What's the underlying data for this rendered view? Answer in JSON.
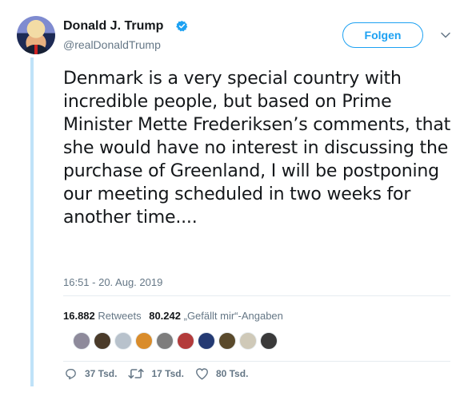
{
  "user": {
    "name": "Donald J. Trump",
    "handle": "@realDonaldTrump",
    "verified": true,
    "follow_label": "Folgen"
  },
  "tweet": {
    "text": "Denmark is a very special country with incredible people, but based on Prime Minister Mette Frederiksen’s comments, that she would have no interest in discussing the purchase of Greenland, I will be postponing our meeting scheduled in two weeks for another time....",
    "timestamp": "16:51 - 20. Aug. 2019"
  },
  "stats": {
    "retweets_count": "16.882",
    "retweets_label": "Retweets",
    "likes_count": "80.242",
    "likes_label": "„Gefällt mir“-Angaben"
  },
  "liker_avatars": [
    {
      "color": "#8e8a9b"
    },
    {
      "color": "#4a3b2a"
    },
    {
      "color": "#b8c2cc"
    },
    {
      "color": "#d98c2b"
    },
    {
      "color": "#7d7d7d"
    },
    {
      "color": "#b33b3b"
    },
    {
      "color": "#243a73"
    },
    {
      "color": "#5a4a2c"
    },
    {
      "color": "#cfc9b8"
    },
    {
      "color": "#3a3a3a"
    }
  ],
  "actions": {
    "replies": "37 Tsd.",
    "retweets": "17 Tsd.",
    "likes": "80 Tsd."
  },
  "colors": {
    "accent": "#1da1f2",
    "thread_rail": "#bfe2f8",
    "secondary_text": "#657786"
  }
}
